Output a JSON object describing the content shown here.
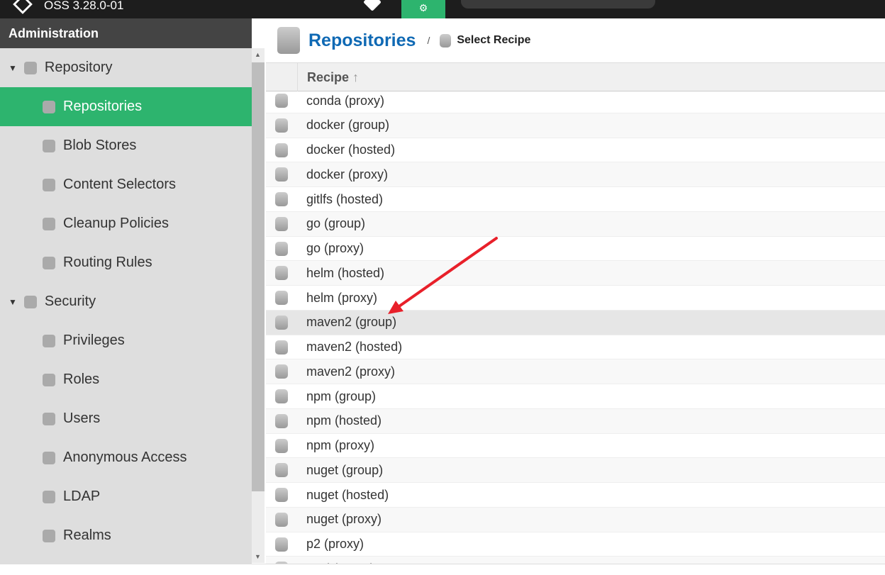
{
  "header": {
    "version": "OSS 3.28.0-01"
  },
  "sidebar": {
    "title": "Administration",
    "items": [
      {
        "label": "Repository",
        "type": "group",
        "icon": "database-icon"
      },
      {
        "label": "Repositories",
        "icon": "database-icon",
        "selected": true
      },
      {
        "label": "Blob Stores",
        "icon": "server-icon"
      },
      {
        "label": "Content Selectors",
        "icon": "selector-icon"
      },
      {
        "label": "Cleanup Policies",
        "icon": "broom-icon"
      },
      {
        "label": "Routing Rules",
        "icon": "router-icon"
      },
      {
        "label": "Security",
        "type": "group",
        "icon": "police-icon"
      },
      {
        "label": "Privileges",
        "icon": "medal-icon"
      },
      {
        "label": "Roles",
        "icon": "role-icon"
      },
      {
        "label": "Users",
        "icon": "users-icon"
      },
      {
        "label": "Anonymous Access",
        "icon": "user-icon"
      },
      {
        "label": "LDAP",
        "icon": "book-icon"
      },
      {
        "label": "Realms",
        "icon": "shield-icon"
      }
    ]
  },
  "main": {
    "title": "Repositories",
    "breadcrumb": "Select Recipe",
    "column": "Recipe",
    "rows": [
      "conda (proxy)",
      "docker (group)",
      "docker (hosted)",
      "docker (proxy)",
      "gitlfs (hosted)",
      "go (group)",
      "go (proxy)",
      "helm (hosted)",
      "helm (proxy)",
      "maven2 (group)",
      "maven2 (hosted)",
      "maven2 (proxy)",
      "npm (group)",
      "npm (hosted)",
      "npm (proxy)",
      "nuget (group)",
      "nuget (hosted)",
      "nuget (proxy)",
      "p2 (proxy)",
      "pypi (group)"
    ],
    "hovered": "maven2 (group)"
  },
  "colors": {
    "accent": "#2db46e",
    "title": "#0f69b4",
    "annotation": "#e8202a"
  }
}
